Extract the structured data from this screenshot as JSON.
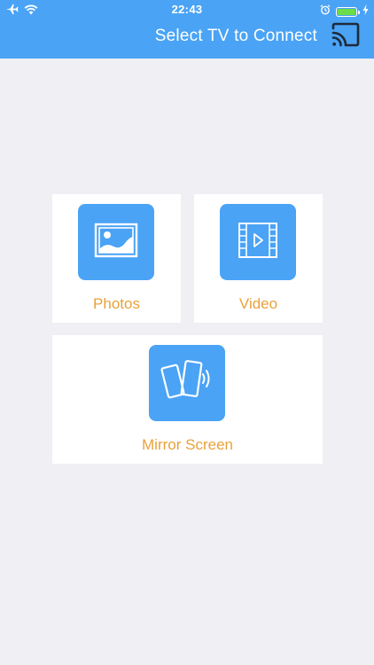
{
  "status_bar": {
    "time": "22:43"
  },
  "nav": {
    "title": "Select TV to Connect"
  },
  "cards": {
    "photos": {
      "label": "Photos",
      "icon": "photo-icon"
    },
    "video": {
      "label": "Video",
      "icon": "video-icon"
    },
    "mirror": {
      "label": "Mirror Screen",
      "icon": "mirror-screen-icon"
    }
  },
  "colors": {
    "accent": "#4aa3f5",
    "label": "#e8a23a",
    "background": "#efeff4",
    "card": "#ffffff"
  }
}
